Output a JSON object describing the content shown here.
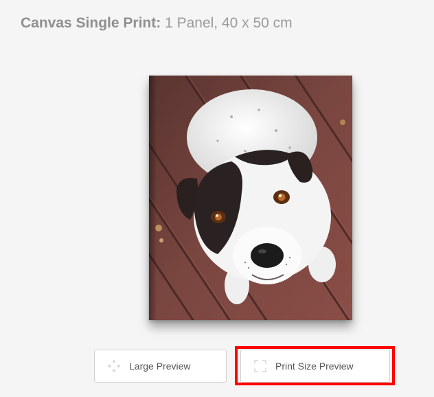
{
  "header": {
    "product_name": "Canvas Single Print:",
    "product_detail": " 1 Panel, 40 x 50 cm"
  },
  "preview": {
    "subject": "dog photo on canvas"
  },
  "buttons": {
    "large_preview": "Large Preview",
    "print_size_preview": "Print Size Preview"
  },
  "icons": {
    "large_preview_icon": "expand-arrows-icon",
    "print_size_icon": "frame-corners-icon"
  },
  "colors": {
    "highlight": "#ff0000",
    "background": "#f5f5f5"
  }
}
